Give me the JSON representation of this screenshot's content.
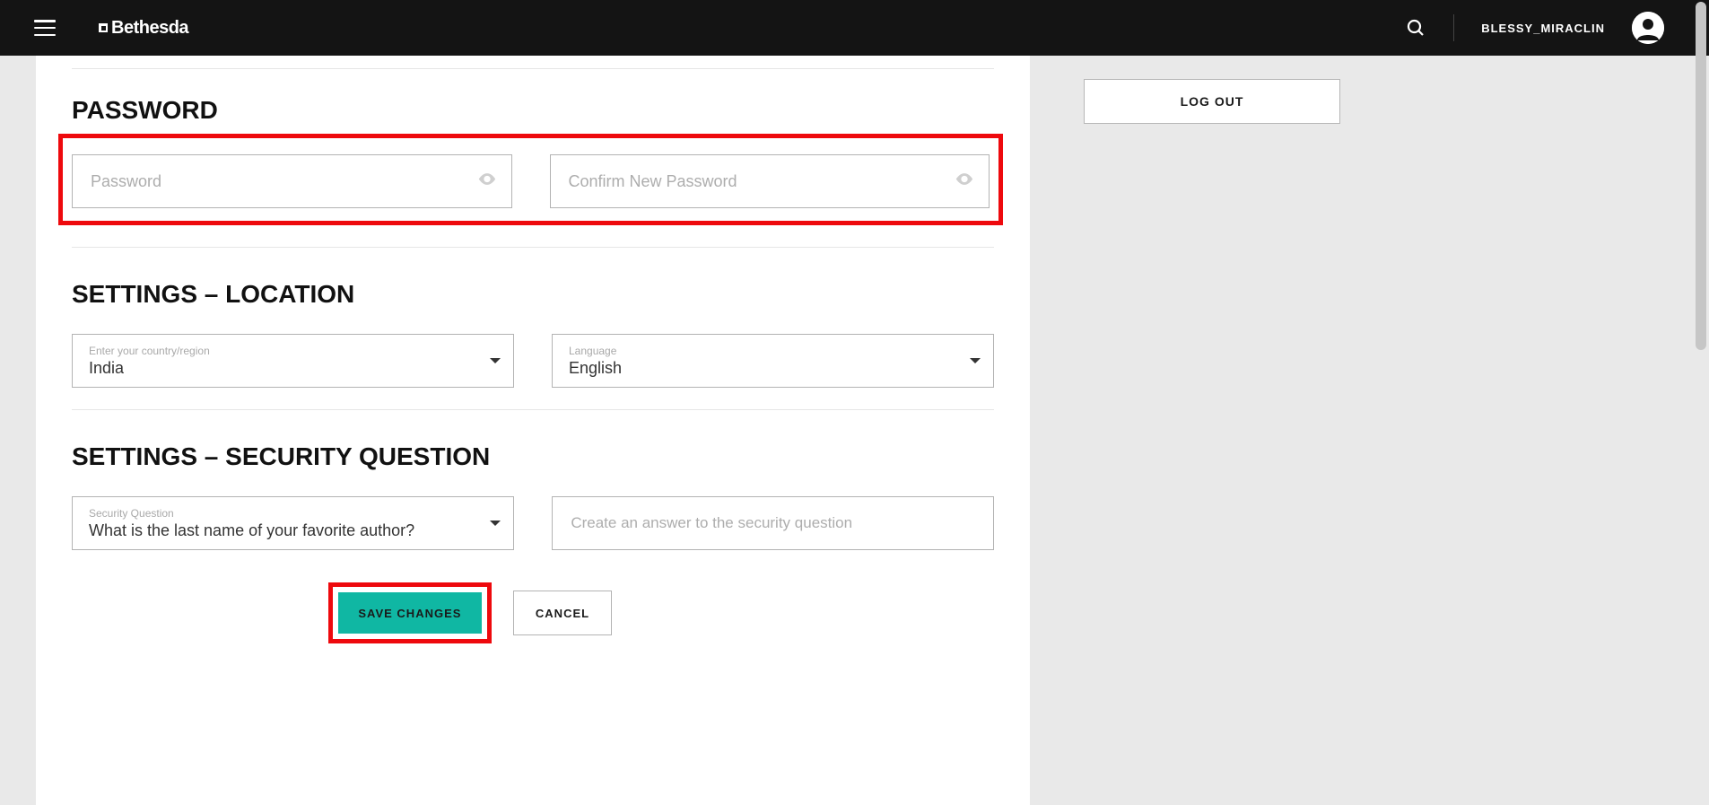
{
  "header": {
    "brand": "Bethesda",
    "username": "BLESSY_MIRACLIN"
  },
  "sidebar": {
    "logout_label": "LOG OUT"
  },
  "sections": {
    "password_title": "PASSWORD",
    "location_title": "SETTINGS – LOCATION",
    "security_title": "SETTINGS – SECURITY QUESTION"
  },
  "password": {
    "placeholder": "Password",
    "confirm_placeholder": "Confirm New Password"
  },
  "location": {
    "country_label": "Enter your country/region",
    "country_value": "India",
    "language_label": "Language",
    "language_value": "English"
  },
  "security": {
    "question_label": "Security Question",
    "question_value": "What is the last name of your favorite author?",
    "answer_placeholder": "Create an answer to the security question"
  },
  "buttons": {
    "save": "SAVE CHANGES",
    "cancel": "CANCEL"
  }
}
